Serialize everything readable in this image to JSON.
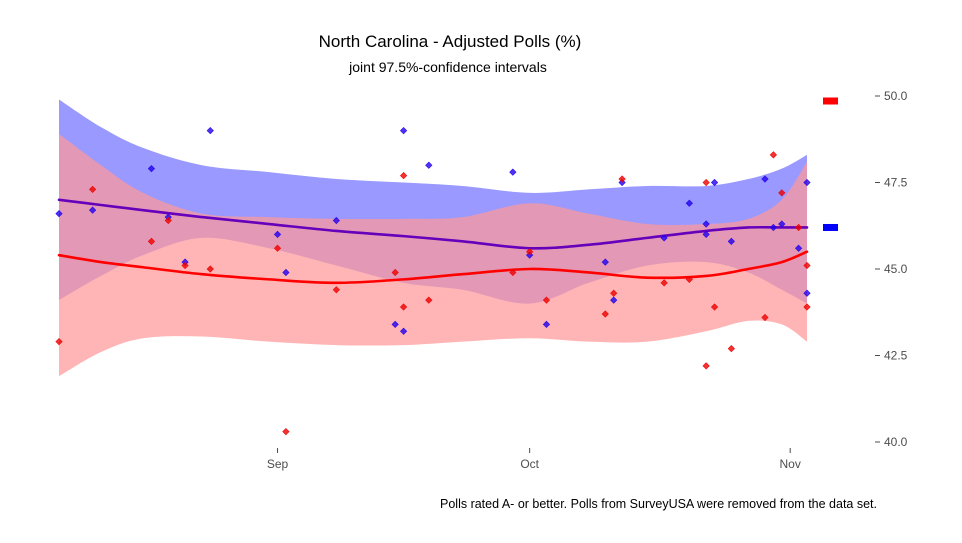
{
  "chart_data": {
    "type": "line",
    "title": "North Carolina - Adjusted Polls (%)",
    "subtitle": "joint 97.5%-confidence intervals",
    "caption": "Polls rated A- or better. Polls from SurveyUSA were removed from the data set.",
    "x_axis": {
      "range": [
        "2020-08-06",
        "2020-11-03"
      ],
      "tick_dates": [
        "2020-09-01",
        "2020-10-01",
        "2020-11-01"
      ],
      "tick_labels": [
        "Sep",
        "Oct",
        "Nov"
      ]
    },
    "y_axis": {
      "range": [
        39.7,
        50.2
      ],
      "position": "right",
      "ticks": [
        40.0,
        42.5,
        45.0,
        47.5,
        50.0
      ],
      "tick_labels": [
        "40.0",
        "42.5",
        "45.0",
        "47.5",
        "50.0"
      ]
    },
    "grid": false,
    "legend": {
      "position": "right",
      "shows_labels": false
    },
    "series": [
      {
        "color": "#0000ff",
        "band_color": "#9999ff",
        "final_value": 46.2,
        "trend": [
          {
            "x": "2020-08-06",
            "y": 47.0,
            "lo": 44.1,
            "hi": 49.9
          },
          {
            "x": "2020-08-11",
            "y": 46.85,
            "lo": 44.8,
            "hi": 49.1
          },
          {
            "x": "2020-08-16",
            "y": 46.7,
            "lo": 45.4,
            "hi": 48.5
          },
          {
            "x": "2020-08-23",
            "y": 46.5,
            "lo": 45.9,
            "hi": 48.0
          },
          {
            "x": "2020-08-31",
            "y": 46.3,
            "lo": 45.6,
            "hi": 47.8
          },
          {
            "x": "2020-09-08",
            "y": 46.1,
            "lo": 45.1,
            "hi": 47.6
          },
          {
            "x": "2020-09-16",
            "y": 45.95,
            "lo": 44.6,
            "hi": 47.5
          },
          {
            "x": "2020-09-23",
            "y": 45.8,
            "lo": 44.4,
            "hi": 47.4
          },
          {
            "x": "2020-10-01",
            "y": 45.6,
            "lo": 44.0,
            "hi": 47.2
          },
          {
            "x": "2020-10-08",
            "y": 45.7,
            "lo": 44.6,
            "hi": 47.3
          },
          {
            "x": "2020-10-15",
            "y": 45.9,
            "lo": 45.1,
            "hi": 47.4
          },
          {
            "x": "2020-10-22",
            "y": 46.1,
            "lo": 45.2,
            "hi": 47.4
          },
          {
            "x": "2020-10-27",
            "y": 46.2,
            "lo": 44.9,
            "hi": 47.6
          },
          {
            "x": "2020-10-31",
            "y": 46.2,
            "lo": 44.4,
            "hi": 47.9
          },
          {
            "x": "2020-11-03",
            "y": 46.2,
            "lo": 44.0,
            "hi": 48.3
          }
        ]
      },
      {
        "color": "#ff0000",
        "band_color": "#ff9999",
        "final_value": 45.5,
        "trend": [
          {
            "x": "2020-08-06",
            "y": 45.4,
            "lo": 41.9,
            "hi": 48.9
          },
          {
            "x": "2020-08-11",
            "y": 45.2,
            "lo": 42.6,
            "hi": 48.0
          },
          {
            "x": "2020-08-16",
            "y": 45.05,
            "lo": 43.0,
            "hi": 47.2
          },
          {
            "x": "2020-08-23",
            "y": 44.85,
            "lo": 43.05,
            "hi": 46.6
          },
          {
            "x": "2020-08-31",
            "y": 44.7,
            "lo": 42.9,
            "hi": 46.5
          },
          {
            "x": "2020-09-08",
            "y": 44.6,
            "lo": 42.8,
            "hi": 46.45
          },
          {
            "x": "2020-09-16",
            "y": 44.7,
            "lo": 42.8,
            "hi": 46.45
          },
          {
            "x": "2020-09-23",
            "y": 44.85,
            "lo": 42.9,
            "hi": 46.5
          },
          {
            "x": "2020-10-01",
            "y": 45.0,
            "lo": 43.0,
            "hi": 46.9
          },
          {
            "x": "2020-10-08",
            "y": 44.9,
            "lo": 42.9,
            "hi": 46.6
          },
          {
            "x": "2020-10-15",
            "y": 44.75,
            "lo": 42.9,
            "hi": 46.3
          },
          {
            "x": "2020-10-22",
            "y": 44.8,
            "lo": 43.2,
            "hi": 46.3
          },
          {
            "x": "2020-10-27",
            "y": 45.0,
            "lo": 43.5,
            "hi": 46.45
          },
          {
            "x": "2020-10-31",
            "y": 45.2,
            "lo": 43.4,
            "hi": 47.0
          },
          {
            "x": "2020-11-03",
            "y": 45.5,
            "lo": 42.9,
            "hi": 48.1
          }
        ]
      }
    ],
    "polls": [
      {
        "x": "2020-08-06",
        "blue": 46.6,
        "red": 42.9
      },
      {
        "x": "2020-08-10",
        "blue": 46.7,
        "red": 47.3
      },
      {
        "x": "2020-08-17",
        "blue": 47.9,
        "red": 45.8
      },
      {
        "x": "2020-08-19",
        "blue": 46.5,
        "red": 46.4
      },
      {
        "x": "2020-08-21",
        "blue": 45.2,
        "red": 45.1
      },
      {
        "x": "2020-08-24",
        "blue": 49.0,
        "red": 45.0
      },
      {
        "x": "2020-09-01",
        "blue": 46.0,
        "red": 45.6
      },
      {
        "x": "2020-09-02",
        "blue": 44.9,
        "red": 40.3
      },
      {
        "x": "2020-09-08",
        "blue": 46.4,
        "red": 44.4
      },
      {
        "x": "2020-09-15",
        "blue": 43.4,
        "red": 44.9
      },
      {
        "x": "2020-09-16",
        "blue": 49.0,
        "red": 47.7
      },
      {
        "x": "2020-09-16",
        "blue": 43.2,
        "red": 43.9
      },
      {
        "x": "2020-09-19",
        "blue": 48.0,
        "red": 44.1
      },
      {
        "x": "2020-09-29",
        "blue": 47.8,
        "red": 44.9
      },
      {
        "x": "2020-10-01",
        "blue": 45.4,
        "red": 45.5
      },
      {
        "x": "2020-10-03",
        "blue": 43.4,
        "red": 44.1
      },
      {
        "x": "2020-10-10",
        "blue": 45.2,
        "red": 43.7
      },
      {
        "x": "2020-10-11",
        "blue": 44.1,
        "red": 44.3
      },
      {
        "x": "2020-10-12",
        "blue": 47.5,
        "red": 47.6
      },
      {
        "x": "2020-10-17",
        "blue": 45.9,
        "red": 44.6
      },
      {
        "x": "2020-10-20",
        "blue": 46.9,
        "red": 44.7
      },
      {
        "x": "2020-10-22",
        "blue": 46.3,
        "red": 47.5
      },
      {
        "x": "2020-10-22",
        "blue": 46.0,
        "red": 42.2
      },
      {
        "x": "2020-10-23",
        "blue": 47.5,
        "red": 43.9
      },
      {
        "x": "2020-10-25",
        "blue": 45.8,
        "red": 42.7
      },
      {
        "x": "2020-10-29",
        "blue": 47.6,
        "red": 43.6
      },
      {
        "x": "2020-10-30",
        "blue": 46.2,
        "red": 48.3
      },
      {
        "x": "2020-10-31",
        "blue": 46.3,
        "red": 47.2
      },
      {
        "x": "2020-11-02",
        "blue": 45.6,
        "red": 46.2
      },
      {
        "x": "2020-11-03",
        "blue": 47.5,
        "red": 45.1
      },
      {
        "x": "2020-11-03",
        "blue": 44.3,
        "red": 43.9
      }
    ]
  }
}
